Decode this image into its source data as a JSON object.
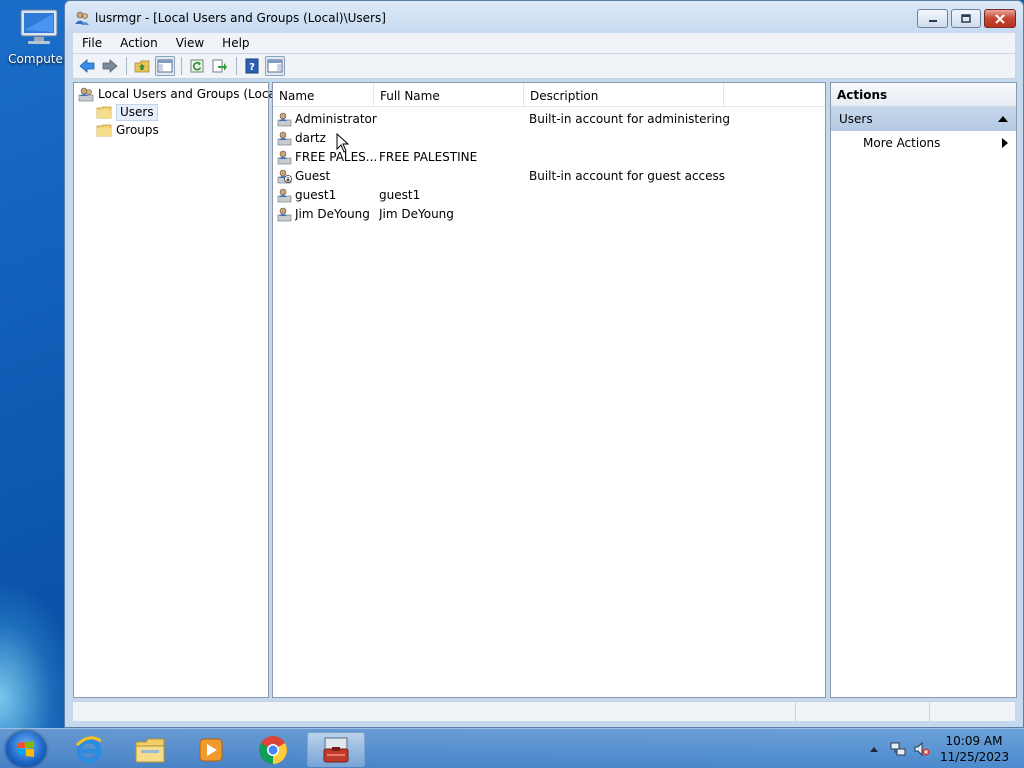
{
  "desktop": {
    "icons": [
      {
        "label": "Computer",
        "icon": "computer-icon"
      }
    ]
  },
  "window": {
    "title": "lusrmgr - [Local Users and Groups (Local)\\Users]",
    "controls": {
      "minimize": "minimize",
      "maximize": "maximize",
      "close": "close"
    }
  },
  "menubar": {
    "items": [
      "File",
      "Action",
      "View",
      "Help"
    ]
  },
  "toolbar": {
    "buttons": [
      "back-arrow-icon",
      "forward-arrow-icon",
      "up-folder-icon",
      "show-hide-tree-icon",
      "refresh-icon",
      "export-list-icon",
      "help-icon",
      "show-hide-action-pane-icon"
    ]
  },
  "tree": {
    "root": "Local Users and Groups (Local)",
    "children": [
      "Users",
      "Groups"
    ],
    "selected": "Users"
  },
  "list": {
    "columns": [
      "Name",
      "Full Name",
      "Description"
    ],
    "rows": [
      {
        "name": "Administrator",
        "full_name": "",
        "description": "Built-in account for administering...",
        "icon": "user-icon"
      },
      {
        "name": "dartz",
        "full_name": "",
        "description": "",
        "icon": "user-icon"
      },
      {
        "name": "FREE PALES...",
        "full_name": "FREE PALESTINE",
        "description": "",
        "icon": "user-icon"
      },
      {
        "name": "Guest",
        "full_name": "",
        "description": "Built-in account for guest access t...",
        "icon": "disabled-user-icon"
      },
      {
        "name": "guest1",
        "full_name": "guest1",
        "description": "",
        "icon": "user-icon"
      },
      {
        "name": "Jim DeYoung",
        "full_name": "Jim DeYoung",
        "description": "",
        "icon": "user-icon"
      }
    ]
  },
  "actions": {
    "title": "Actions",
    "section": "Users",
    "items": [
      "More Actions"
    ]
  },
  "taskbar": {
    "pinned": [
      "internet-explorer-icon",
      "file-explorer-icon",
      "media-player-icon",
      "chrome-icon",
      "computer-management-icon"
    ],
    "active": "computer-management-icon",
    "clock_time": "10:09 AM",
    "clock_date": "11/25/2023"
  },
  "colors": {
    "selection": "#e5eefa",
    "actions_section": "#b4c9e2",
    "close_button": "#c4442f"
  }
}
